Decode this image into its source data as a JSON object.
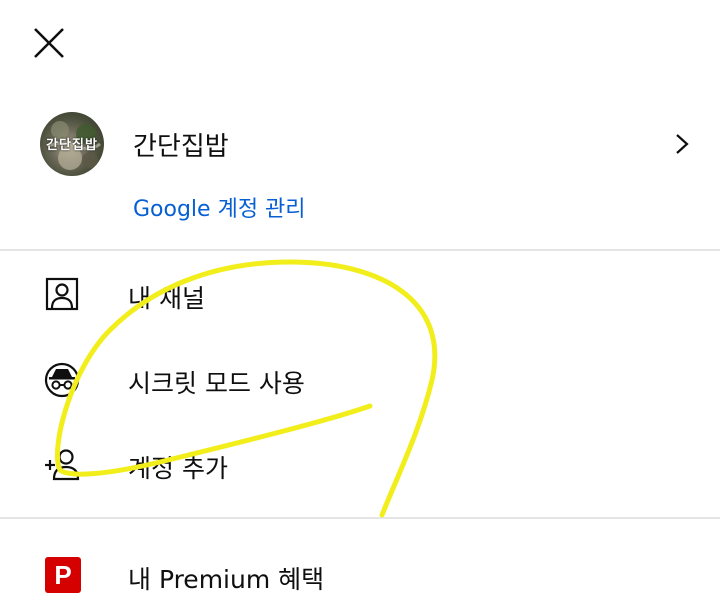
{
  "account": {
    "name": "간단집밥",
    "avatar_text": "간단집밥",
    "manage_link": "Google 계정 관리"
  },
  "menu": {
    "items": [
      {
        "label": "내 채널",
        "icon": "person-square-icon"
      },
      {
        "label": "시크릿 모드 사용",
        "icon": "incognito-icon"
      },
      {
        "label": "계정 추가",
        "icon": "add-person-icon"
      }
    ],
    "premium": {
      "label": "내 Premium 혜택",
      "badge": "P",
      "icon": "premium-badge-icon"
    }
  },
  "colors": {
    "link": "#065fd4",
    "premium_red": "#d50000",
    "annotation": "#f2ee1c"
  }
}
